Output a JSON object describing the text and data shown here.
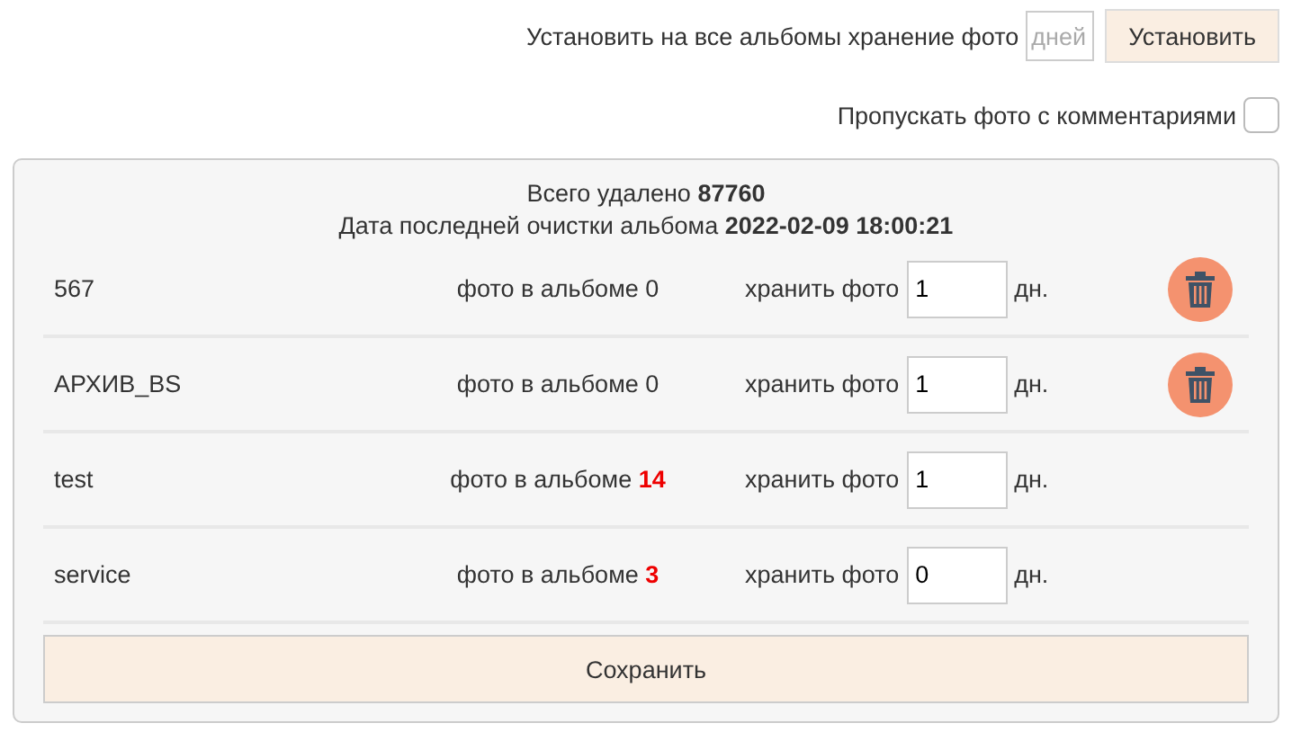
{
  "bulk_retention": {
    "label": "Установить на все альбомы хранение фото",
    "placeholder": "дней",
    "button": "Установить"
  },
  "skip_commented": {
    "label": "Пропускать фото с комментариями",
    "checked": false
  },
  "summary": {
    "deleted": "Всего удалено **87760**",
    "last_cleanup": "Дата последней очистки альбома **2022-02-09 18:00:21**"
  },
  "albums": [
    {
      "name": "567",
      "count_label": "фото в альбоме",
      "count": "0",
      "highlight": false,
      "keep_label": "хранить фото",
      "keep_days": "1",
      "unit": "дн.",
      "deletable": true
    },
    {
      "name": "АРХИВ_BS",
      "count_label": "фото в альбоме",
      "count": "0",
      "highlight": false,
      "keep_label": "хранить фото",
      "keep_days": "1",
      "unit": "дн.",
      "deletable": true
    },
    {
      "name": "test",
      "count_label": "фото в альбоме",
      "count": "14",
      "highlight": true,
      "keep_label": "хранить фото",
      "keep_days": "1",
      "unit": "дн.",
      "deletable": false
    },
    {
      "name": "service",
      "count_label": "фото в альбоме",
      "count": "3",
      "highlight": true,
      "keep_label": "хранить фото",
      "keep_days": "0",
      "unit": "дн.",
      "deletable": false
    }
  ],
  "save_button": "Сохранить"
}
